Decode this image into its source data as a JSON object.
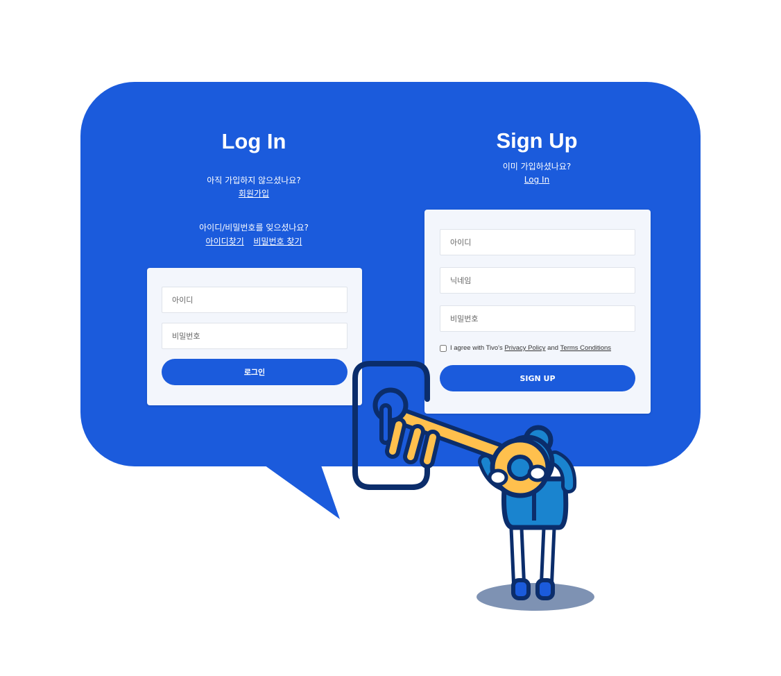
{
  "login": {
    "title": "Log In",
    "no_account_text": "아직 가입하지 않으셨나요?",
    "signup_link": "회원가입",
    "forgot_text": "아이디/비밀번호를 잊으셨나요?",
    "find_id_link": "아이디찾기",
    "find_pw_link": "비밀번호 찾기",
    "id_placeholder": "아이디",
    "pw_placeholder": "비밀번호",
    "submit_label": "로그인"
  },
  "signup": {
    "title": "Sign Up",
    "have_account_text": "이미 가입하셨나요?",
    "login_link": "Log In",
    "id_placeholder": "아이디",
    "nickname_placeholder": "닉네임",
    "pw_placeholder": "비밀번호",
    "agree_prefix": "I agree with Tivo's",
    "privacy_link": "Privacy Policy",
    "agree_and": "and",
    "terms_link": "Terms Conditions",
    "submit_label": "SIGN UP"
  },
  "colors": {
    "brand_blue": "#1b5bdc",
    "card_bg": "#f3f6fc",
    "key_yellow": "#ffc04d",
    "outline_navy": "#0b2d6b"
  },
  "icons": [
    "speech-bubble",
    "key-icon",
    "keyhole-icon",
    "person-illustration"
  ]
}
